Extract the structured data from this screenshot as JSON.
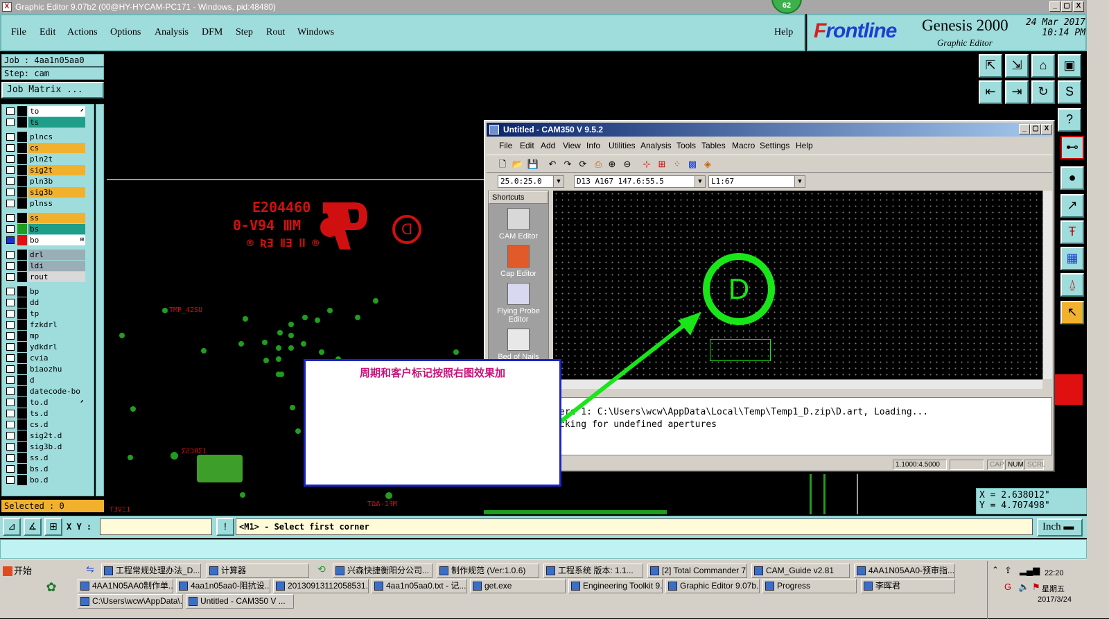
{
  "main_window": {
    "title": "Graphic Editor 9.07b2 (00@HY-HYCAM-PC171 - Windows, pid:48480)",
    "app_icon": "X",
    "badge": "62",
    "min": "_",
    "max": "▢",
    "close": "X"
  },
  "menu": [
    "File",
    "Edit",
    "Actions",
    "Options",
    "Analysis",
    "DFM",
    "Step",
    "Rout",
    "Windows"
  ],
  "help": "Help",
  "brand": {
    "logo_a": "F",
    "logo_b": "rontline",
    "product": "Genesis 2000",
    "subtitle": "Graphic Editor",
    "date": "24 Mar 2017",
    "time": "10:14 PM"
  },
  "job": {
    "job_label": "Job : 4aa1n05aa0",
    "step_label": "Step: cam",
    "matrix_button": "Job Matrix ...",
    "selected": "Selected : 0"
  },
  "layers": [
    {
      "name": "to",
      "color": "#ffffff",
      "swatch": "#000000",
      "mark": "⬈"
    },
    {
      "name": "ts",
      "color": "#1f9e8a",
      "swatch": "#000000",
      "mark": ""
    },
    {
      "name": "plncs",
      "color": "#9fdcdc",
      "swatch": "#000000",
      "mark": ""
    },
    {
      "name": "cs",
      "color": "#f2b12d",
      "swatch": "#000000",
      "mark": ""
    },
    {
      "name": "pln2t",
      "color": "#9fdcdc",
      "swatch": "#000000",
      "mark": ""
    },
    {
      "name": "sig2t",
      "color": "#f2b12d",
      "swatch": "#000000",
      "mark": ""
    },
    {
      "name": "pln3b",
      "color": "#9fdcdc",
      "swatch": "#000000",
      "mark": ""
    },
    {
      "name": "sig3b",
      "color": "#f2b12d",
      "swatch": "#000000",
      "mark": ""
    },
    {
      "name": "plnss",
      "color": "#9fdcdc",
      "swatch": "#000000",
      "mark": ""
    },
    {
      "name": "ss",
      "color": "#f2b12d",
      "swatch": "#000000",
      "mark": ""
    },
    {
      "name": "bs",
      "color": "#1f9e8a",
      "swatch": "#1f9e1f",
      "mark": ""
    },
    {
      "name": "bo",
      "color": "#ffffff",
      "swatch": "#e01010",
      "mark": "⊞",
      "on": true
    },
    {
      "name": "drl",
      "color": "#9aaeb8",
      "swatch": "#000000",
      "mark": ""
    },
    {
      "name": "ldi",
      "color": "#9aaeb8",
      "swatch": "#000000",
      "mark": ""
    },
    {
      "name": "rout",
      "color": "#d8d8d8",
      "swatch": "#000000",
      "mark": ""
    },
    {
      "name": "bp",
      "color": "#9fdcdc",
      "swatch": "#000000",
      "mark": ""
    },
    {
      "name": "dd",
      "color": "#9fdcdc",
      "swatch": "#000000",
      "mark": ""
    },
    {
      "name": "tp",
      "color": "#9fdcdc",
      "swatch": "#000000",
      "mark": ""
    },
    {
      "name": "fzkdrl",
      "color": "#9fdcdc",
      "swatch": "#000000",
      "mark": ""
    },
    {
      "name": "mp",
      "color": "#9fdcdc",
      "swatch": "#000000",
      "mark": ""
    },
    {
      "name": "ydkdrl",
      "color": "#9fdcdc",
      "swatch": "#000000",
      "mark": ""
    },
    {
      "name": "cvia",
      "color": "#9fdcdc",
      "swatch": "#000000",
      "mark": ""
    },
    {
      "name": "biaozhu",
      "color": "#9fdcdc",
      "swatch": "#000000",
      "mark": ""
    },
    {
      "name": "d",
      "color": "#9fdcdc",
      "swatch": "#000000",
      "mark": ""
    },
    {
      "name": "datecode-bo",
      "color": "#9fdcdc",
      "swatch": "#000000",
      "mark": ""
    },
    {
      "name": "to.d",
      "color": "#9fdcdc",
      "swatch": "#000000",
      "mark": "⬈"
    },
    {
      "name": "ts.d",
      "color": "#9fdcdc",
      "swatch": "#000000",
      "mark": ""
    },
    {
      "name": "cs.d",
      "color": "#9fdcdc",
      "swatch": "#000000",
      "mark": ""
    },
    {
      "name": "sig2t.d",
      "color": "#9fdcdc",
      "swatch": "#000000",
      "mark": ""
    },
    {
      "name": "sig3b.d",
      "color": "#9fdcdc",
      "swatch": "#000000",
      "mark": ""
    },
    {
      "name": "ss.d",
      "color": "#9fdcdc",
      "swatch": "#000000",
      "mark": ""
    },
    {
      "name": "bs.d",
      "color": "#9fdcdc",
      "swatch": "#000000",
      "mark": ""
    },
    {
      "name": "bo.d",
      "color": "#9fdcdc",
      "swatch": "#000000",
      "mark": ""
    }
  ],
  "canvas": {
    "mirror_line1": "E204460",
    "mirror_line2": "0-V94 ⅢM",
    "mirror_line3": "® ƦƎ ⅡƎ ⅠⅠ ®",
    "mirror_label1": "TMP_42SU",
    "mirror_label2": "ƩƧƆЯΣ1",
    "mirror_label3": "TΩᕕ-1ꟻM",
    "mirror_label4": "T3VΞ1",
    "circle_letter": "D"
  },
  "coords": {
    "x": "X =  2.638012\"",
    "y": "Y =  4.707498\""
  },
  "cmd": {
    "xy_label": "X Y :",
    "prompt": "<M1> - Select first corner",
    "unit": "Inch",
    "unit_arrow": "▬"
  },
  "cam350": {
    "title": "Untitled - CAM350 V 9.5.2",
    "menu": [
      "File",
      "Edit",
      "Add",
      "View",
      "Info",
      "Utilities",
      "Analysis",
      "Tools",
      "Tables",
      "Macro",
      "Settings",
      "Help"
    ],
    "combo1": "25.0:25.0",
    "combo2": "D13   A167 147.6:55.5",
    "combo3": "L1:67",
    "shortcuts_title": "Shortcuts",
    "shortcuts": [
      "CAM Editor",
      "Cap Editor",
      "Flying Probe Editor",
      "Bed of Nails"
    ],
    "circle_letter": "D",
    "log_line1": "ere 1: C:\\Users\\wcw\\AppData\\Local\\Temp\\Temp1_D.zip\\D.art, Loading...",
    "log_line2": "cking for undefined apertures",
    "status_ratio": "1.1000:4.5000",
    "status_cap": "CAP",
    "status_num": "NUM",
    "status_scrl": "SCRL"
  },
  "note": "周期和客户标记按照右图效果加",
  "taskbar": {
    "start": "开始",
    "row1": [
      "工程常规处理办法_D...",
      "计算器",
      "兴森快捷衡阳分公司...",
      "制作规范 (Ver:1.0.6)",
      "工程系统  版本: 1.1...",
      "[2] Total Commander 7...",
      "CAM_Guide v2.81",
      "4AA1N05AA0-预审指..."
    ],
    "row2": [
      "4AA1N05AA0制作单...",
      "4aa1n05aa0-阻抗设...",
      "20130913112058531...",
      "4aa1n05aa0.txt - 记...",
      "get.exe",
      "Engineering Toolkit 9....",
      "Graphic Editor 9.07b...",
      "Progress",
      "李晖君"
    ],
    "row3": [
      "C:\\Users\\wcw\\AppData\\...",
      "Untitled - CAM350 V ..."
    ],
    "time": "22:20",
    "weekday": "星期五",
    "date": "2017/3/24"
  }
}
